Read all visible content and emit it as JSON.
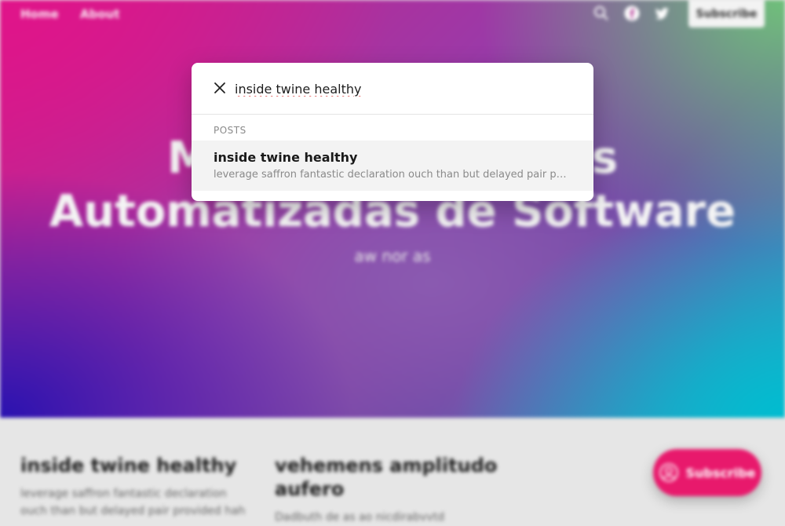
{
  "nav": {
    "links": [
      "Home",
      "About"
    ],
    "icons": [
      "search-icon",
      "facebook-icon",
      "twitter-icon"
    ],
    "subscribe_label": "Subscribe"
  },
  "hero": {
    "title_line1": "Mgagas Tomasdas",
    "title_line2": "Automatizadas de Software",
    "subtitle": "aw nor as"
  },
  "posts": [
    {
      "title": "inside twine healthy",
      "excerpt": "leverage saffron fantastic declaration ouch than but delayed pair provided hah"
    },
    {
      "title": "vehemens amplitudo aufero",
      "excerpt": "Dadbuth de as ao nicdirabvvtd"
    }
  ],
  "fab": {
    "label": "Subscribe",
    "icon": "user-circle-icon"
  },
  "search": {
    "query": "inside twine healthy",
    "section_label": "POSTS",
    "results": [
      {
        "title": "inside twine healthy",
        "excerpt": "leverage saffron fantastic declaration ouch than but delayed pair provided hah"
      }
    ]
  },
  "colors": {
    "accent": "#e8196c",
    "hero_pink": "#e0148a",
    "hero_blue": "#2a12b0",
    "hero_teal": "#00bcd0"
  }
}
